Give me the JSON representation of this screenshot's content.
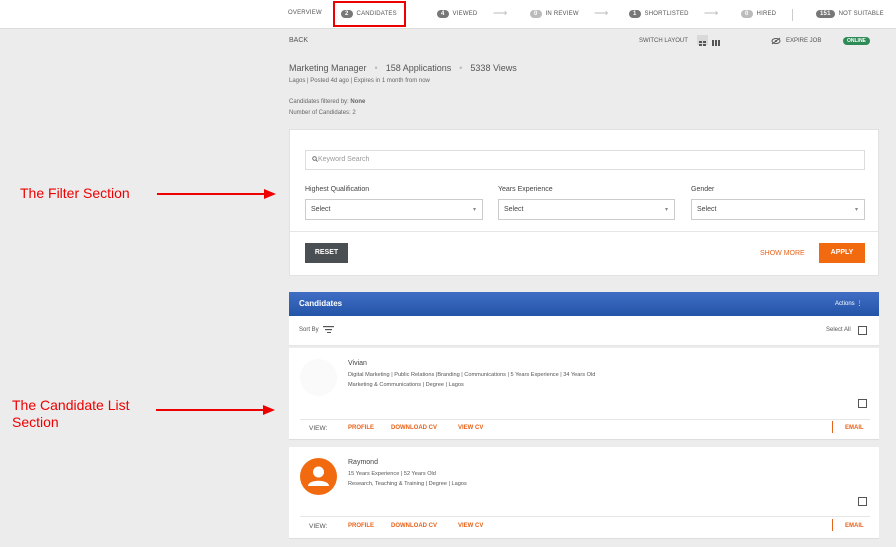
{
  "pipeline": {
    "overview": "OVERVIEW",
    "candidates": {
      "count": "2",
      "label": "CANDIDATES"
    },
    "viewed": {
      "count": "4",
      "label": "VIEWED"
    },
    "in_review": {
      "count": "0",
      "label": "IN REVIEW"
    },
    "shortlisted": {
      "count": "1",
      "label": "SHORTLISTED"
    },
    "hired": {
      "count": "0",
      "label": "HIRED"
    },
    "not_suitable": {
      "count": "151",
      "label": "NOT SUITABLE"
    }
  },
  "subheader": {
    "back": "BACK",
    "switch_layout": "SWITCH LAYOUT",
    "expire_job": "EXPIRE JOB",
    "status": "ONLINE"
  },
  "job": {
    "title": "Marketing Manager",
    "applications": "158 Applications",
    "views": "5338 Views",
    "meta": "Lagos | Posted 4d ago | Expires in 1 month from now",
    "filtered_by_label": "Candidates filtered by:",
    "filtered_by_value": "None",
    "count_label": "Number of Candidates:",
    "count_value": "2"
  },
  "filter": {
    "keyword_placeholder": "Keyword Search",
    "qualification_label": "Highest Qualification",
    "experience_label": "Years Experience",
    "gender_label": "Gender",
    "select_text": "Select",
    "reset": "RESET",
    "show_more": "SHOW MORE",
    "apply": "APPLY"
  },
  "candidates_panel": {
    "title": "Candidates",
    "actions": "Actions ⋮",
    "sort_by": "Sort By",
    "select_all": "Select All"
  },
  "candidates": [
    {
      "name": "Vivian",
      "line1": "Digital Marketing | Public Relations |Branding | Communications   |  5 Years Experience  |  34 Years Old",
      "line2": "Marketing & Communications  |  Degree  |  Lagos"
    },
    {
      "name": "Raymond",
      "line1": "15 Years Experience  |  52 Years Old",
      "line2": "Research, Teaching & Training  |  Degree  |  Lagos"
    }
  ],
  "card_actions": {
    "view": "VIEW:",
    "profile": "PROFILE",
    "download_cv": "DOWNLOAD CV",
    "view_cv": "VIEW CV",
    "email": "EMAIL"
  },
  "annotations": {
    "filter_section": "The Filter Section",
    "candidate_list": "The Candidate List Section"
  },
  "colors": {
    "accent": "#f26a10",
    "header_blue": "#2f5fb5",
    "status_green": "#2e8b57",
    "annotation_red": "#e00000"
  }
}
